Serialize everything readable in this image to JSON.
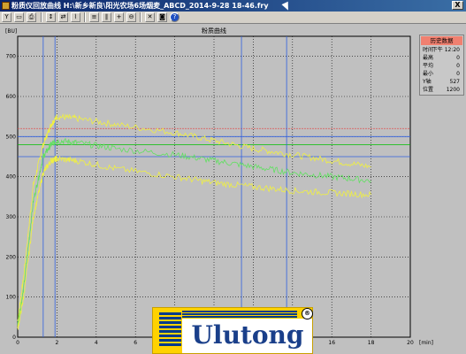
{
  "window": {
    "title": "粉质仪回放曲线  H:\\新乡新良\\阳光农场6场烟麦_ABCD_2014-9-28 18-46.fry",
    "close_label": "X"
  },
  "toolbar": {
    "buttons": [
      {
        "name": "filter-icon",
        "glyph": "Y"
      },
      {
        "name": "open-file-icon",
        "glyph": "▭"
      },
      {
        "name": "print-icon",
        "glyph": "⎙"
      },
      {
        "name": "marker-a-icon",
        "glyph": "↕"
      },
      {
        "name": "marker-b-icon",
        "glyph": "⇄"
      },
      {
        "name": "chart-icon",
        "glyph": "⌇"
      },
      {
        "name": "grid-icon",
        "glyph": "≡"
      },
      {
        "name": "column-icon",
        "glyph": "∥"
      },
      {
        "name": "zoom-in-icon",
        "glyph": "+"
      },
      {
        "name": "zoom-out-icon",
        "glyph": "⊖"
      },
      {
        "name": "tools-icon",
        "glyph": "✕"
      },
      {
        "name": "camera-icon",
        "glyph": "◙"
      },
      {
        "name": "help-icon",
        "glyph": "?"
      }
    ]
  },
  "chart_data": {
    "type": "line",
    "title": "粉质曲线",
    "xlabel": "[min]",
    "ylabel": "[BU]",
    "xlim": [
      0,
      20
    ],
    "ylim": [
      0,
      750
    ],
    "xticks": [
      0,
      2,
      4,
      6,
      8,
      10,
      12,
      14,
      16,
      18,
      20
    ],
    "yticks": [
      0,
      100,
      200,
      300,
      400,
      500,
      600,
      700
    ],
    "grid": true,
    "reference_lines": [
      {
        "y": 520,
        "color": "#e05050",
        "style": "dashed"
      },
      {
        "y": 500,
        "color": "#3060e0",
        "style": "solid"
      },
      {
        "y": 480,
        "color": "#00c000",
        "style": "solid"
      },
      {
        "y": 450,
        "color": "#3060e0",
        "style": "solid"
      }
    ],
    "markers": [
      {
        "x": 1.3,
        "color": "#3060e0"
      },
      {
        "x": 1.9,
        "color": "#3060e0"
      },
      {
        "x": 11.4,
        "color": "#3060e0"
      },
      {
        "x": 13.7,
        "color": "#3060e0"
      }
    ],
    "series": [
      {
        "color": "#f0f040",
        "x": [
          0,
          0.3,
          0.8,
          1.3,
          1.7,
          2.0,
          3,
          5,
          8,
          10,
          12,
          14,
          16,
          18
        ],
        "y": [
          40,
          150,
          380,
          480,
          530,
          550,
          545,
          530,
          510,
          490,
          470,
          455,
          440,
          425
        ]
      },
      {
        "color": "#60e060",
        "x": [
          0,
          0.3,
          0.8,
          1.3,
          1.7,
          2.0,
          3,
          5,
          8,
          10,
          12,
          14,
          16,
          18
        ],
        "y": [
          30,
          120,
          340,
          450,
          480,
          490,
          485,
          470,
          455,
          440,
          425,
          410,
          400,
          390
        ]
      },
      {
        "color": "#f0f040",
        "x": [
          0,
          0.3,
          0.8,
          1.3,
          1.7,
          2.0,
          3,
          5,
          8,
          10,
          12,
          14,
          16,
          18
        ],
        "y": [
          20,
          100,
          300,
          410,
          440,
          445,
          440,
          420,
          400,
          385,
          375,
          365,
          360,
          355
        ]
      }
    ]
  },
  "history_panel": {
    "title": "历史数据",
    "rows": [
      {
        "label": "时间",
        "value": "下午 12:20"
      },
      {
        "label": "最高",
        "value": "0"
      },
      {
        "label": "平均",
        "value": "0"
      },
      {
        "label": "最小",
        "value": "0"
      },
      {
        "label": "Y轴",
        "value": "527"
      },
      {
        "label": "位置",
        "value": "1200"
      }
    ]
  },
  "logo": {
    "text": "Ulutong",
    "reg_mark": "®"
  }
}
